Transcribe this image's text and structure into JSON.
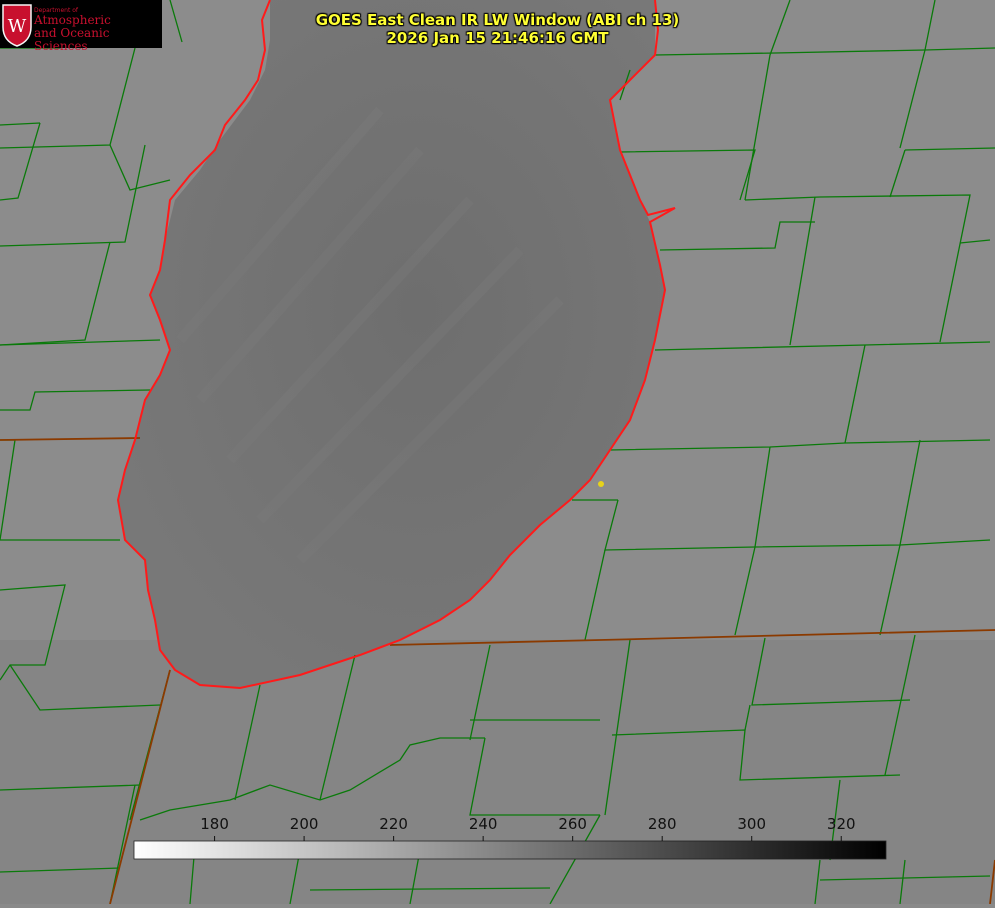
{
  "logo": {
    "dept_label": "Department of",
    "line1": "Atmospheric",
    "line2": "and Oceanic Sciences",
    "letter": "W"
  },
  "title": {
    "line1": "GOES East Clean IR LW Window (ABI ch 13)",
    "line2": "2026 Jan 15 21:46:16 GMT"
  },
  "colorbar": {
    "ticks": [
      "180",
      "200",
      "220",
      "240",
      "260",
      "280",
      "300",
      "320"
    ],
    "tick_values": [
      180,
      200,
      220,
      240,
      260,
      280,
      300,
      320
    ],
    "range": [
      162,
      330
    ],
    "gradient_from": "#ffffff",
    "gradient_to": "#000000"
  },
  "colors": {
    "background": "#8a8a8a",
    "lake": "#707070",
    "county_lines": "#0a7a0a",
    "state_lines": "#8b3a00",
    "coastline": "#ff1a1a",
    "title_text": "#ffff33",
    "marker": "#e6d21a"
  }
}
